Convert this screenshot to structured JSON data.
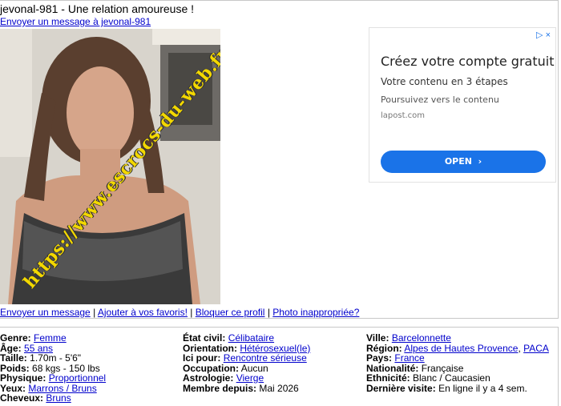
{
  "header": {
    "title": "jevonal-981 - Une relation amoureuse !",
    "send_message": "Envoyer un message à jevonal-981"
  },
  "photo": {
    "watermark": "https://www.escrocs-du-web.fr"
  },
  "ad": {
    "title": "Créez votre compte gratuit",
    "subtitle": "Votre contenu en 3 étapes",
    "line": "Poursuivez vers le contenu",
    "domain": "lapost.com",
    "button": "OPEN",
    "adchoice": "▷ ×"
  },
  "actions": {
    "send": "Envoyer un message",
    "favorite": "Ajouter à vos favoris!",
    "block": "Bloquer ce profil",
    "report": "Photo inappropriée?",
    "separator": "|"
  },
  "details": {
    "col1": [
      {
        "label": "Genre:",
        "value": "Femme",
        "link": true
      },
      {
        "label": "Âge:",
        "value": "55 ans",
        "link": true
      },
      {
        "label": "Taille:",
        "value": "1.70m - 5'6\"",
        "link": false
      },
      {
        "label": "Poids:",
        "value": "68 kgs - 150 lbs",
        "link": false
      },
      {
        "label": "Physique:",
        "value": "Proportionnel",
        "link": true
      },
      {
        "label": "Yeux:",
        "value": "Marrons / Bruns",
        "link": true
      },
      {
        "label": "Cheveux:",
        "value": "Bruns",
        "link": true
      }
    ],
    "col2": [
      {
        "label": "État civil:",
        "value": "Célibataire",
        "link": true
      },
      {
        "label": "Orientation:",
        "value": "Hétérosexuel(le)",
        "link": true
      },
      {
        "label": "Ici pour:",
        "value": "Rencontre sérieuse",
        "link": true
      },
      {
        "label": "Occupation:",
        "value": "Aucun",
        "link": false
      },
      {
        "label": "Astrologie:",
        "value": "Vierge",
        "link": true
      },
      {
        "label": "Membre depuis:",
        "value": "Mai 2026",
        "link": false
      }
    ],
    "col3": [
      {
        "label": "Ville:",
        "value": "Barcelonnette",
        "link": true
      },
      {
        "label": "Région:",
        "value": "Alpes de Hautes Provence",
        "value2": "PACA",
        "link": true
      },
      {
        "label": "Pays:",
        "value": "France",
        "link": true
      },
      {
        "label": "Nationalité:",
        "value": "Française",
        "link": false
      },
      {
        "label": "Ethnicité:",
        "value": "Blanc / Caucasien",
        "link": false
      },
      {
        "label": "Dernière visite:",
        "value": "En ligne il y a 4 sem.",
        "link": false
      }
    ]
  }
}
